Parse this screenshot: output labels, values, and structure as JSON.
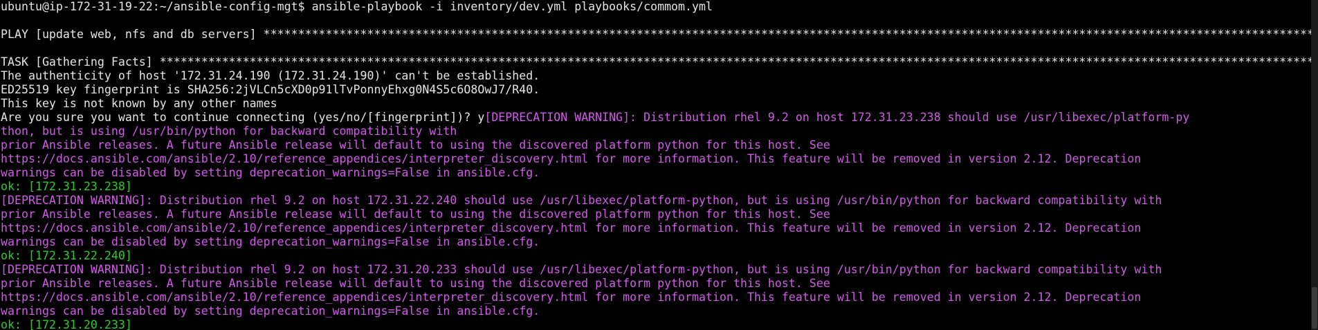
{
  "colors": {
    "background": "#000000",
    "white": "#E5E5E5",
    "magenta": "#D05CE6",
    "green": "#2FCB2F"
  },
  "lines": [
    {
      "segments": [
        {
          "text": "ubuntu@ip-172-31-19-22:~/ansible-config-mgt$ ansible-playbook -i inventory/dev.yml playbooks/commom.yml",
          "color": "white"
        }
      ]
    },
    {
      "segments": [
        {
          "text": "",
          "color": "white"
        }
      ]
    },
    {
      "segments": [
        {
          "text": "PLAY [update web, nfs and db servers] ****************************************************************************************************************************************************************",
          "color": "white"
        }
      ]
    },
    {
      "segments": [
        {
          "text": "",
          "color": "white"
        }
      ]
    },
    {
      "segments": [
        {
          "text": "TASK [Gathering Facts] ***************************************************************************************************************************************************************************",
          "color": "white"
        }
      ]
    },
    {
      "segments": [
        {
          "text": "The authenticity of host '172.31.24.190 (172.31.24.190)' can't be established.",
          "color": "white"
        }
      ]
    },
    {
      "segments": [
        {
          "text": "ED25519 key fingerprint is SHA256:2jVLCn5cXD0p91lTvPonnyEhxg0N4S5c6O8OwJ7/R40.",
          "color": "white"
        }
      ]
    },
    {
      "segments": [
        {
          "text": "This key is not known by any other names",
          "color": "white"
        }
      ]
    },
    {
      "segments": [
        {
          "text": "Are you sure you want to continue connecting (yes/no/[fingerprint])? y",
          "color": "white"
        },
        {
          "text": "[DEPRECATION WARNING]: Distribution rhel 9.2 on host 172.31.23.238 should use /usr/libexec/platform-py",
          "color": "magenta"
        }
      ]
    },
    {
      "segments": [
        {
          "text": "thon, but is using /usr/bin/python for backward compatibility with",
          "color": "magenta"
        }
      ]
    },
    {
      "segments": [
        {
          "text": "prior Ansible releases. A future Ansible release will default to using the discovered platform python for this host. See",
          "color": "magenta"
        }
      ]
    },
    {
      "segments": [
        {
          "text": "https://docs.ansible.com/ansible/2.10/reference_appendices/interpreter_discovery.html for more information. This feature will be removed in version 2.12. Deprecation",
          "color": "magenta"
        }
      ]
    },
    {
      "segments": [
        {
          "text": "warnings can be disabled by setting deprecation_warnings=False in ansible.cfg.",
          "color": "magenta"
        }
      ]
    },
    {
      "segments": [
        {
          "text": "ok: [172.31.23.238]",
          "color": "green"
        }
      ]
    },
    {
      "segments": [
        {
          "text": "[DEPRECATION WARNING]: Distribution rhel 9.2 on host 172.31.22.240 should use /usr/libexec/platform-python, but is using /usr/bin/python for backward compatibility with",
          "color": "magenta"
        }
      ]
    },
    {
      "segments": [
        {
          "text": "prior Ansible releases. A future Ansible release will default to using the discovered platform python for this host. See",
          "color": "magenta"
        }
      ]
    },
    {
      "segments": [
        {
          "text": "https://docs.ansible.com/ansible/2.10/reference_appendices/interpreter_discovery.html for more information. This feature will be removed in version 2.12. Deprecation",
          "color": "magenta"
        }
      ]
    },
    {
      "segments": [
        {
          "text": "warnings can be disabled by setting deprecation_warnings=False in ansible.cfg.",
          "color": "magenta"
        }
      ]
    },
    {
      "segments": [
        {
          "text": "ok: [172.31.22.240]",
          "color": "green"
        }
      ]
    },
    {
      "segments": [
        {
          "text": "[DEPRECATION WARNING]: Distribution rhel 9.2 on host 172.31.20.233 should use /usr/libexec/platform-python, but is using /usr/bin/python for backward compatibility with",
          "color": "magenta"
        }
      ]
    },
    {
      "segments": [
        {
          "text": "prior Ansible releases. A future Ansible release will default to using the discovered platform python for this host. See",
          "color": "magenta"
        }
      ]
    },
    {
      "segments": [
        {
          "text": "https://docs.ansible.com/ansible/2.10/reference_appendices/interpreter_discovery.html for more information. This feature will be removed in version 2.12. Deprecation",
          "color": "magenta"
        }
      ]
    },
    {
      "segments": [
        {
          "text": "warnings can be disabled by setting deprecation_warnings=False in ansible.cfg.",
          "color": "magenta"
        }
      ]
    },
    {
      "segments": [
        {
          "text": "ok: [172.31.20.233]",
          "color": "green"
        }
      ]
    }
  ]
}
